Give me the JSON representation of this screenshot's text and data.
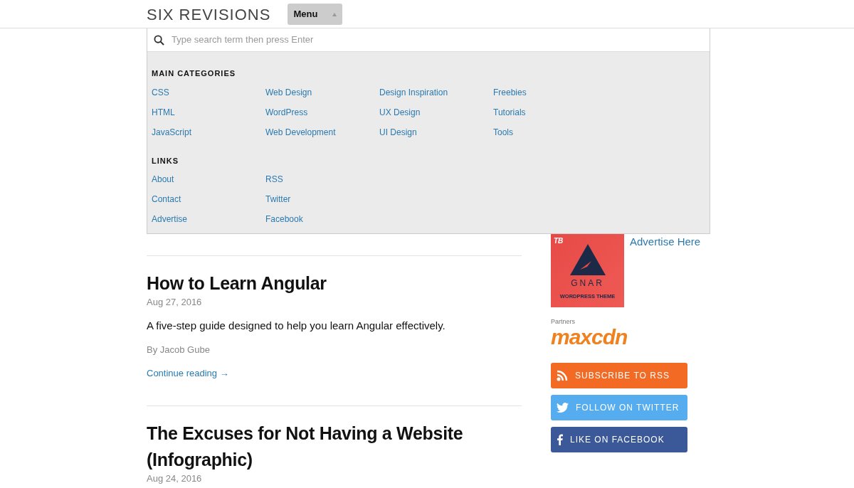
{
  "header": {
    "logo": "SIX REVISIONS",
    "menu_button": {
      "label": "Menu",
      "expanded": true
    }
  },
  "menu": {
    "search": {
      "placeholder": "Type search term then press Enter"
    },
    "sections": [
      {
        "heading": "MAIN CATEGORIES",
        "columns": [
          [
            "CSS",
            "HTML",
            "JavaScript"
          ],
          [
            "Web Design",
            "WordPress",
            "Web Development"
          ],
          [
            "Design Inspiration",
            "UX Design",
            "UI Design"
          ],
          [
            "Freebies",
            "Tutorials",
            "Tools"
          ]
        ]
      },
      {
        "heading": "LINKS",
        "columns": [
          [
            "About",
            "Contact",
            "Advertise"
          ],
          [
            "RSS",
            "Twitter",
            "Facebook"
          ]
        ]
      }
    ]
  },
  "articles": [
    {
      "title": "How to Learn Angular",
      "date": "Aug 27, 2016",
      "excerpt": "A five-step guide designed to help you learn Angular effectively.",
      "author": "By Jacob Gube",
      "link": "Continue reading →"
    },
    {
      "title": "The Excuses for Not Having a Website (Infographic)",
      "date": "Aug 24, 2016"
    }
  ],
  "sidebar": {
    "ad": {
      "badge": "TB",
      "title": "GNAR",
      "subtitle": "WORDPRESS THEME"
    },
    "ad_link": "Advertise Here",
    "partners_label": "Partners",
    "partner_logo": "maxcdn",
    "social_buttons": [
      {
        "kind": "rss",
        "label": "SUBSCRIBE TO RSS"
      },
      {
        "kind": "twitter",
        "label": "FOLLOW ON TWITTER"
      },
      {
        "kind": "facebook",
        "label": "LIKE ON FACEBOOK"
      }
    ]
  }
}
